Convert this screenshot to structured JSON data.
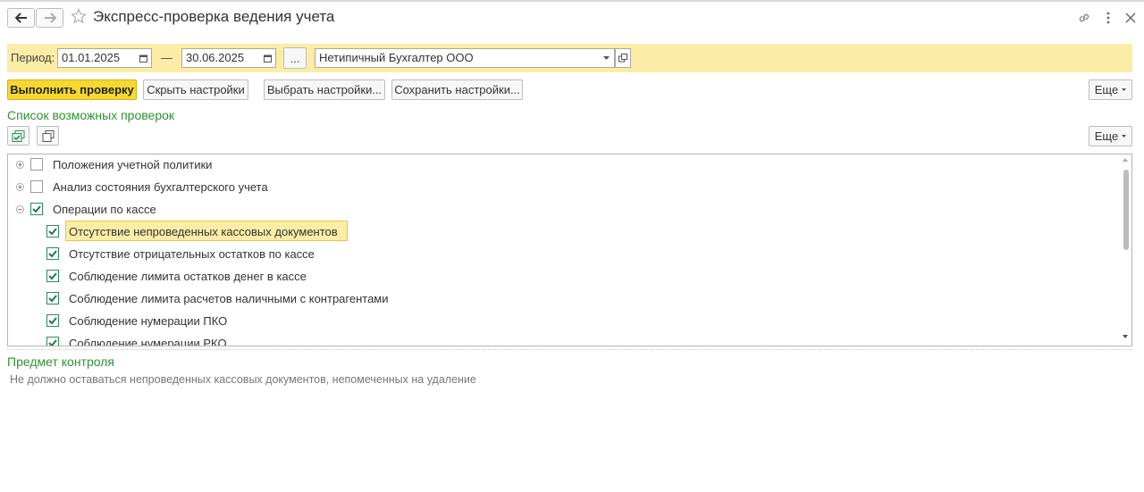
{
  "window": {
    "title": "Экспресс-проверка ведения учета",
    "back_icon": "arrow-left-icon",
    "forward_icon": "arrow-right-icon"
  },
  "filters": {
    "period_label": "Период:",
    "date_from": "01.01.2025",
    "dash": "—",
    "date_to": "30.06.2025",
    "period_select_label": "...",
    "organization": "Нетипичный Бухгалтер ООО"
  },
  "toolbar": {
    "run_check": "Выполнить проверку",
    "hide_settings": "Скрыть настройки",
    "choose_settings": "Выбрать настройки...",
    "save_settings": "Сохранить настройки...",
    "more": "Еще"
  },
  "checks_list": {
    "title": "Список возможных проверок",
    "more": "Еще",
    "rows": [
      {
        "label": "Положения учетной политики",
        "level": 0,
        "expanded": false,
        "checked": false
      },
      {
        "label": "Анализ состояния бухгалтерского учета",
        "level": 0,
        "expanded": false,
        "checked": false
      },
      {
        "label": "Операции по кассе",
        "level": 0,
        "expanded": true,
        "checked": true
      },
      {
        "label": "Отсутствие непроведенных кассовых документов",
        "level": 1,
        "checked": true,
        "selected": true
      },
      {
        "label": "Отсутствие отрицательных остатков по кассе",
        "level": 1,
        "checked": true
      },
      {
        "label": "Соблюдение лимита остатков денег в кассе",
        "level": 1,
        "checked": true
      },
      {
        "label": "Соблюдение лимита расчетов наличными с контрагентами",
        "level": 1,
        "checked": true
      },
      {
        "label": "Соблюдение нумерации ПКО",
        "level": 1,
        "checked": true
      },
      {
        "label": "Соблюдение нумерации РКО",
        "level": 1,
        "checked": true
      }
    ]
  },
  "subject": {
    "title": "Предмет контроля",
    "text": "Не должно оставаться непроведенных кассовых документов, непомеченных на удаление"
  },
  "colors": {
    "accent_green": "#2d9232",
    "filter_bg": "#fbeda5",
    "primary_button": "#f5d932",
    "checkbox_green": "#2e8b57"
  }
}
